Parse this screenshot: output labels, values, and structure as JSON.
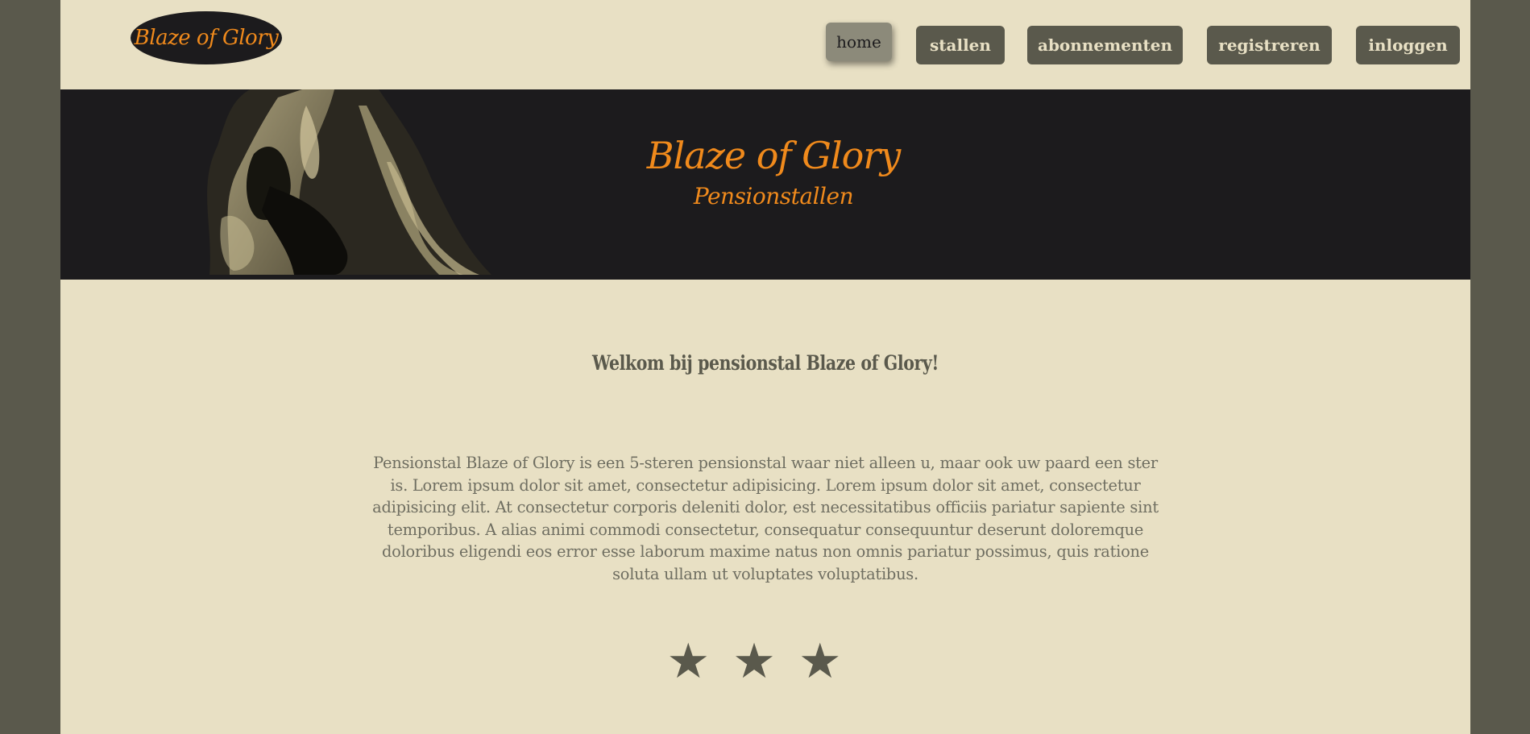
{
  "logo": {
    "text": "Blaze of Glory"
  },
  "nav": {
    "items": [
      {
        "label": "home",
        "active": true
      },
      {
        "label": "stallen",
        "active": false
      },
      {
        "label": "abonnementen",
        "active": false
      },
      {
        "label": "registreren",
        "active": false
      },
      {
        "label": "inloggen",
        "active": false
      }
    ]
  },
  "hero": {
    "title": "Blaze of Glory",
    "subtitle": "Pensionstallen"
  },
  "main": {
    "welcome": "Welkom bij pensionstal Blaze of Glory!",
    "intro": "Pensionstal Blaze of Glory is een 5-steren pensionstal waar niet alleen u, maar ook uw paard een ster is. Lorem ipsum dolor sit amet, consectetur adipisicing. Lorem ipsum dolor sit amet, consectetur adipisicing elit. At consectetur corporis deleniti dolor, est necessitatibus officiis pariatur sapiente sint temporibus. A alias animi commodi consectetur, consequatur consequuntur deserunt doloremque doloribus eligendi eos error esse laborum maxime natus non omnis pariatur possimus, quis ratione soluta ullam ut voluptates voluptatibus.",
    "stars": "★★★"
  },
  "colors": {
    "background": "#5a594c",
    "page": "#e8e0c4",
    "accent": "#f08a1c",
    "hero": "#1c1b1d"
  },
  "icons": {
    "hero_image": "horse-illustration",
    "stars": "star-icon"
  }
}
